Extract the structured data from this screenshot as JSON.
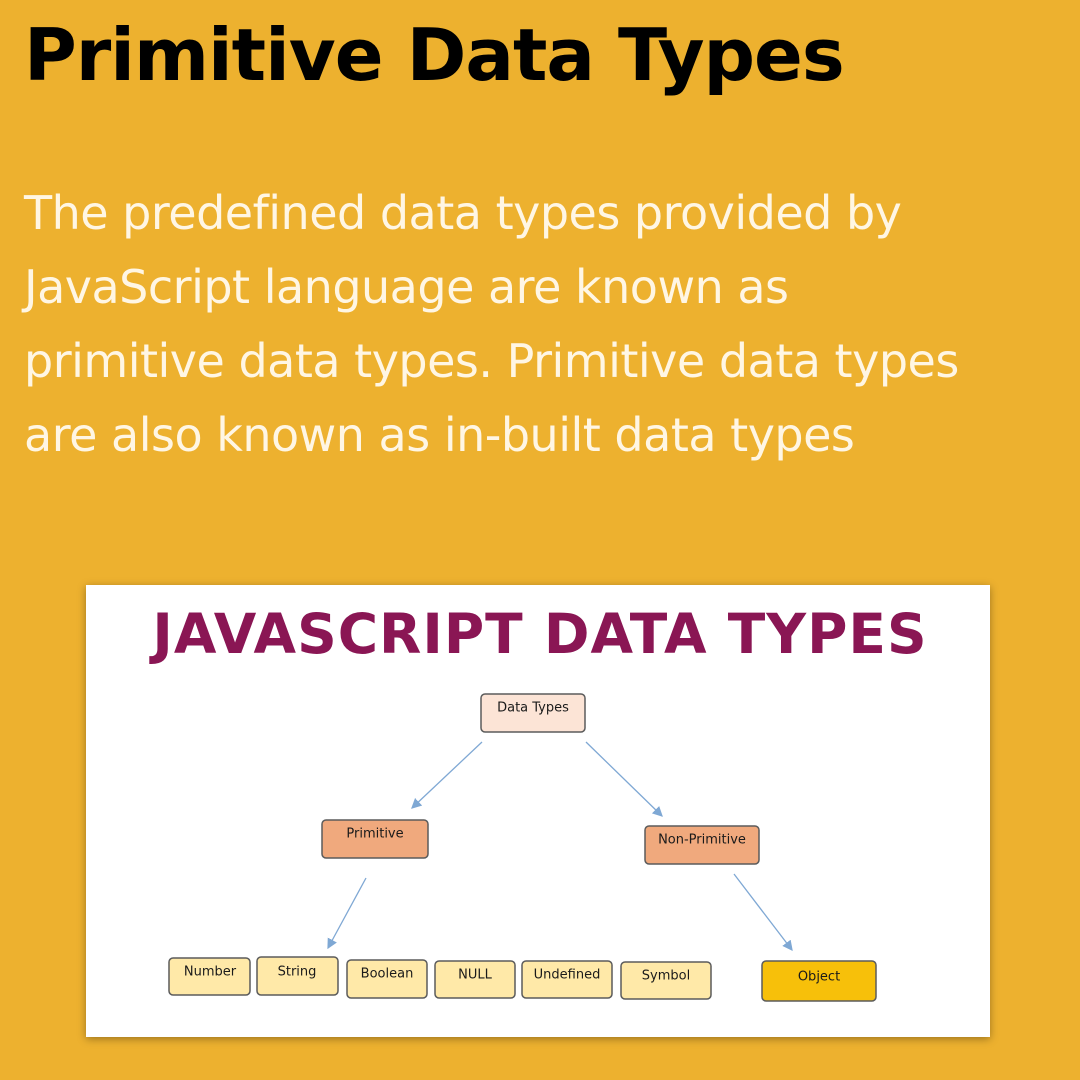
{
  "page": {
    "title": "Primitive Data Types",
    "intro_lines": [
      "The predefined data types provided by",
      "JavaScript language are known as",
      "primitive data types. Primitive data types",
      "are also known as in-built data types"
    ]
  },
  "figure": {
    "title": "Javascript Data Types",
    "nodes": {
      "root": "Data Types",
      "primitive": "Primitive",
      "non_primitive": "Non-Primitive",
      "number": "Number",
      "string": "String",
      "boolean": "Boolean",
      "null": "NULL",
      "undefined": "Undefined",
      "symbol": "Symbol",
      "object": "Object"
    },
    "colors": {
      "background": "#EDB12F",
      "root_fill": "#FCE4D6",
      "category_fill": "#F0A97D",
      "leaf_fill": "#FFE9A8",
      "object_fill": "#F7C00A",
      "title_color": "#8A1654"
    }
  }
}
